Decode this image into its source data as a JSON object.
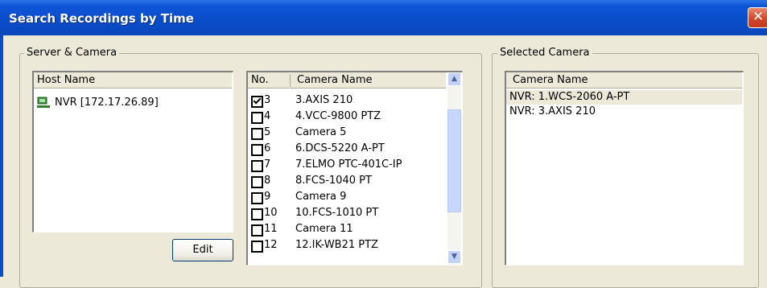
{
  "window": {
    "title": "Search Recordings by Time",
    "close_glyph": "✕"
  },
  "server_camera": {
    "legend": "Server & Camera",
    "host_header": "Host Name",
    "hosts": [
      {
        "label": "NVR [172.17.26.89]",
        "icon": "computer-icon"
      }
    ],
    "edit_label": "Edit",
    "cam_headers": {
      "no": "No.",
      "name": "Camera Name"
    },
    "cameras": [
      {
        "no": "3",
        "name": "3.AXIS 210",
        "checked": true
      },
      {
        "no": "4",
        "name": "4.VCC-9800 PTZ",
        "checked": false
      },
      {
        "no": "5",
        "name": "Camera 5",
        "checked": false
      },
      {
        "no": "6",
        "name": "6.DCS-5220 A-PT",
        "checked": false
      },
      {
        "no": "7",
        "name": "7.ELMO PTC-401C-IP",
        "checked": false
      },
      {
        "no": "8",
        "name": "8.FCS-1040 PT",
        "checked": false
      },
      {
        "no": "9",
        "name": "Camera 9",
        "checked": false
      },
      {
        "no": "10",
        "name": "10.FCS-1010 PT",
        "checked": false
      },
      {
        "no": "11",
        "name": "Camera 11",
        "checked": false
      },
      {
        "no": "12",
        "name": "12.IK-WB21 PTZ",
        "checked": false
      }
    ],
    "scroll_up": "▲",
    "scroll_down": "▼"
  },
  "selected_camera": {
    "legend": "Selected Camera",
    "header": "Camera Name",
    "items": [
      "NVR: 1.WCS-2060 A-PT",
      "NVR: 3.AXIS 210"
    ]
  },
  "colors": {
    "titlebar": "#0a4cc8",
    "selection": "#ece9d8",
    "close": "#d2462a"
  }
}
